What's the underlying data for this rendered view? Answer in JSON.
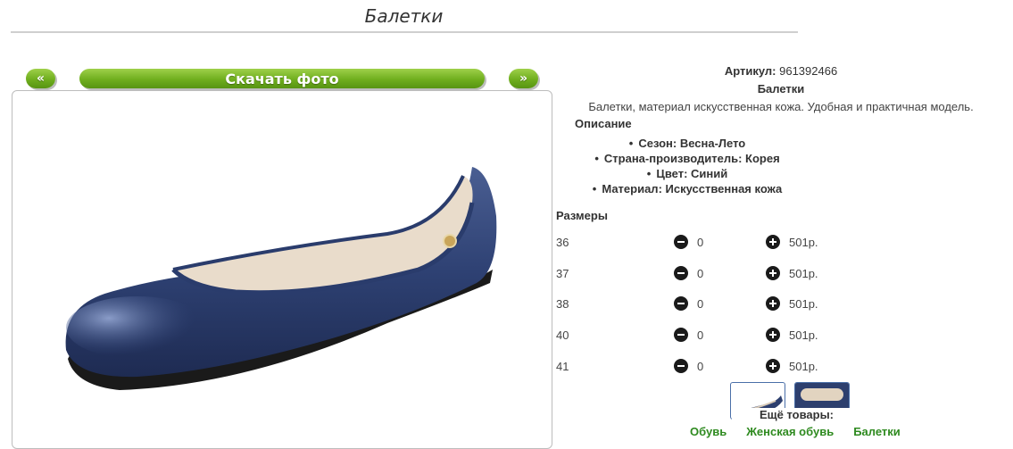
{
  "page": {
    "title": "Балетки"
  },
  "nav": {
    "prev_label": "«",
    "download_label": "Скачать фото",
    "next_label": "»"
  },
  "product": {
    "sku_label": "Артикул:",
    "sku_value": "961392466",
    "name": "Балетки",
    "description": "Балетки, материал искусственная кожа. Удобная и практичная модель.",
    "description_heading": "Описание",
    "attributes": [
      "Сезон: Весна-Лето",
      "Страна-производитель: Корея",
      "Цвет: Синий",
      "Материал: Искусственная кожа"
    ],
    "sizes_heading": "Размеры",
    "sizes": [
      {
        "size": "36",
        "qty": "0",
        "price": "501р."
      },
      {
        "size": "37",
        "qty": "0",
        "price": "501р."
      },
      {
        "size": "38",
        "qty": "0",
        "price": "501р."
      },
      {
        "size": "40",
        "qty": "0",
        "price": "501р."
      },
      {
        "size": "41",
        "qty": "0",
        "price": "501р."
      }
    ]
  },
  "more": {
    "heading": "Ещё товары:",
    "links": [
      "Обувь",
      "Женская обувь",
      "Балетки"
    ]
  },
  "colors": {
    "accent_green": "#6fae1e",
    "shoe_navy": "#2d3f6e",
    "link_green": "#2e8a1f"
  }
}
